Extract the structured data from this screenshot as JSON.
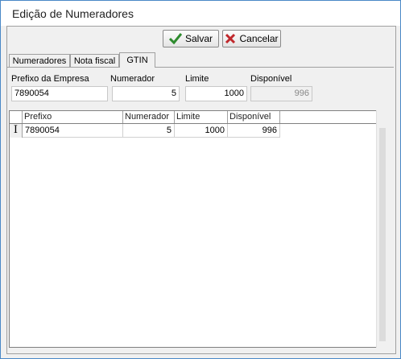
{
  "window": {
    "title": "Edição de Numeradores"
  },
  "toolbar": {
    "save_label": "Salvar",
    "cancel_label": "Cancelar"
  },
  "tabs": [
    {
      "label": "Numeradores"
    },
    {
      "label": "Nota fiscal"
    },
    {
      "label": "GTIN",
      "active": true
    }
  ],
  "form": {
    "prefix_label": "Prefixo da Empresa",
    "prefix_value": "7890054",
    "counter_label": "Numerador",
    "counter_value": "5",
    "limit_label": "Limite",
    "limit_value": "1000",
    "available_label": "Disponível",
    "available_value": "996"
  },
  "grid": {
    "columns": [
      "Prefixo",
      "Numerador",
      "Limite",
      "Disponível"
    ],
    "rows": [
      {
        "indicator": "I",
        "cells": [
          "7890054",
          "5",
          "1000",
          "996"
        ]
      }
    ]
  },
  "colors": {
    "accent_border": "#4a88c7",
    "check": "#2e8b2e",
    "cross": "#c0282c"
  }
}
